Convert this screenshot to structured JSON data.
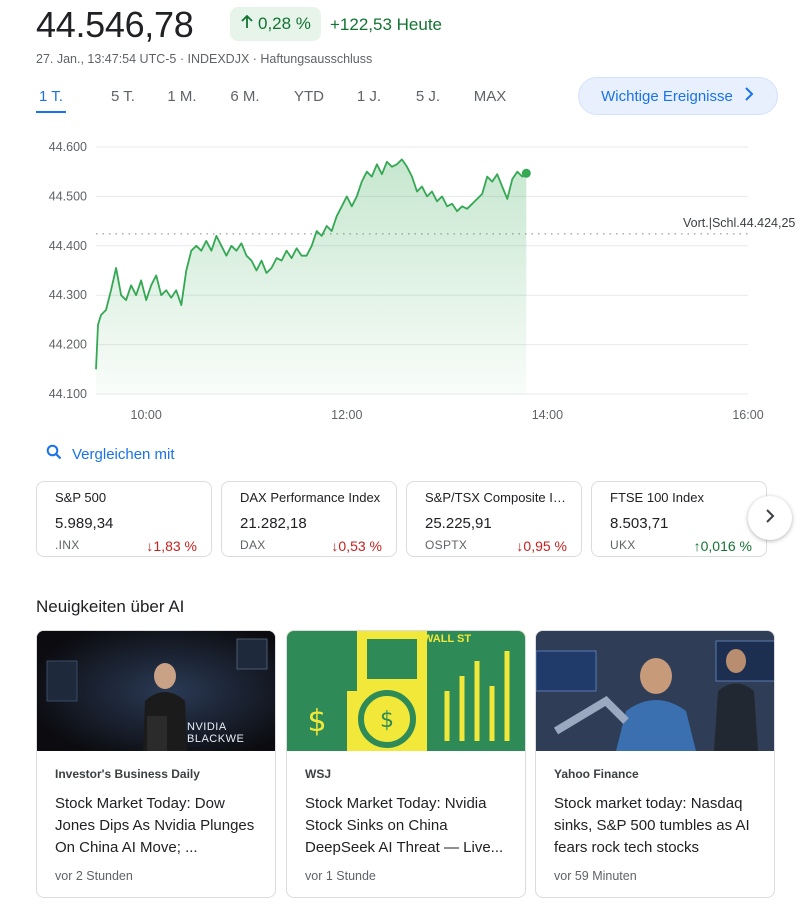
{
  "quote": {
    "price": "44.546,78",
    "change_pct": "0,28 %",
    "change_abs": "+122,53 Heute",
    "meta": "27. Jan., 13:47:54 UTC-5 · INDEXDJX · Haftungsausschluss"
  },
  "ranges": [
    {
      "label": "1 T."
    },
    {
      "label": "5 T."
    },
    {
      "label": "1 M."
    },
    {
      "label": "6 M."
    },
    {
      "label": "YTD"
    },
    {
      "label": "1 J."
    },
    {
      "label": "5 J."
    },
    {
      "label": "MAX"
    }
  ],
  "events_button": "Wichtige Ereignisse",
  "chart_data": {
    "type": "area",
    "x_ticks": [
      "10:00",
      "12:00",
      "14:00",
      "16:00"
    ],
    "y_ticks": [
      "44.600",
      "44.500",
      "44.400",
      "44.300",
      "44.200",
      "44.100"
    ],
    "ylim": [
      44100,
      44600
    ],
    "x_domain_hours": [
      9.5,
      16.0
    ],
    "prev_close_label": "Vort.|Schl.44.424,25",
    "prev_close": 44424.25,
    "color": "#34a853",
    "series": [
      {
        "values": [
          [
            9.5,
            44150
          ],
          [
            9.52,
            44240
          ],
          [
            9.55,
            44260
          ],
          [
            9.6,
            44270
          ],
          [
            9.65,
            44310
          ],
          [
            9.7,
            44355
          ],
          [
            9.75,
            44300
          ],
          [
            9.8,
            44290
          ],
          [
            9.85,
            44320
          ],
          [
            9.9,
            44300
          ],
          [
            9.95,
            44330
          ],
          [
            10.0,
            44290
          ],
          [
            10.05,
            44320
          ],
          [
            10.1,
            44340
          ],
          [
            10.15,
            44300
          ],
          [
            10.2,
            44310
          ],
          [
            10.25,
            44295
          ],
          [
            10.3,
            44310
          ],
          [
            10.35,
            44280
          ],
          [
            10.4,
            44350
          ],
          [
            10.45,
            44390
          ],
          [
            10.5,
            44400
          ],
          [
            10.55,
            44390
          ],
          [
            10.6,
            44410
          ],
          [
            10.65,
            44390
          ],
          [
            10.7,
            44420
          ],
          [
            10.75,
            44400
          ],
          [
            10.8,
            44380
          ],
          [
            10.85,
            44400
          ],
          [
            10.9,
            44390
          ],
          [
            10.95,
            44405
          ],
          [
            11.0,
            44380
          ],
          [
            11.05,
            44370
          ],
          [
            11.1,
            44350
          ],
          [
            11.15,
            44370
          ],
          [
            11.2,
            44345
          ],
          [
            11.25,
            44355
          ],
          [
            11.3,
            44375
          ],
          [
            11.35,
            44370
          ],
          [
            11.4,
            44390
          ],
          [
            11.45,
            44375
          ],
          [
            11.5,
            44395
          ],
          [
            11.55,
            44380
          ],
          [
            11.6,
            44380
          ],
          [
            11.65,
            44400
          ],
          [
            11.7,
            44430
          ],
          [
            11.75,
            44420
          ],
          [
            11.8,
            44440
          ],
          [
            11.85,
            44430
          ],
          [
            11.9,
            44460
          ],
          [
            11.95,
            44480
          ],
          [
            12.0,
            44500
          ],
          [
            12.05,
            44480
          ],
          [
            12.1,
            44500
          ],
          [
            12.15,
            44530
          ],
          [
            12.2,
            44550
          ],
          [
            12.25,
            44540
          ],
          [
            12.3,
            44565
          ],
          [
            12.35,
            44545
          ],
          [
            12.4,
            44570
          ],
          [
            12.45,
            44560
          ],
          [
            12.5,
            44565
          ],
          [
            12.55,
            44575
          ],
          [
            12.6,
            44560
          ],
          [
            12.65,
            44540
          ],
          [
            12.7,
            44510
          ],
          [
            12.75,
            44520
          ],
          [
            12.8,
            44500
          ],
          [
            12.85,
            44510
          ],
          [
            12.9,
            44490
          ],
          [
            12.95,
            44500
          ],
          [
            13.0,
            44480
          ],
          [
            13.05,
            44485
          ],
          [
            13.1,
            44470
          ],
          [
            13.15,
            44480
          ],
          [
            13.2,
            44475
          ],
          [
            13.25,
            44485
          ],
          [
            13.3,
            44495
          ],
          [
            13.35,
            44505
          ],
          [
            13.4,
            44540
          ],
          [
            13.45,
            44530
          ],
          [
            13.5,
            44545
          ],
          [
            13.55,
            44520
          ],
          [
            13.6,
            44495
          ],
          [
            13.65,
            44535
          ],
          [
            13.7,
            44550
          ],
          [
            13.75,
            44540
          ],
          [
            13.79,
            44546.78
          ]
        ]
      }
    ]
  },
  "compare_label": "Vergleichen mit",
  "indices": [
    {
      "name": "S&P 500",
      "value": "5.989,34",
      "symbol": ".INX",
      "change": "1,83 %",
      "dir": "down"
    },
    {
      "name": "DAX Performance Index",
      "value": "21.282,18",
      "symbol": "DAX",
      "change": "0,53 %",
      "dir": "down"
    },
    {
      "name": "S&P/TSX Composite In...",
      "value": "25.225,91",
      "symbol": "OSPTX",
      "change": "0,95 %",
      "dir": "down"
    },
    {
      "name": "FTSE 100 Index",
      "value": "8.503,71",
      "symbol": "UKX",
      "change": "0,016 %",
      "dir": "up"
    }
  ],
  "news_heading": "Neuigkeiten über AI",
  "news": [
    {
      "source": "Investor's Business Daily",
      "headline": "Stock Market Today: Dow Jones Dips As Nvidia Plunges On China AI Move; ...",
      "age": "vor 2 Stunden",
      "img_text": "NVIDIA BLACKWE"
    },
    {
      "source": "WSJ",
      "headline": "Stock Market Today: Nvidia Stock Sinks on China DeepSeek AI Threat — Live...",
      "age": "vor 1 Stunde",
      "img_text": "WALL ST"
    },
    {
      "source": "Yahoo Finance",
      "headline": "Stock market today: Nasdaq sinks, S&P 500 tumbles as AI fears rock tech stocks",
      "age": "vor 59 Minuten"
    }
  ]
}
